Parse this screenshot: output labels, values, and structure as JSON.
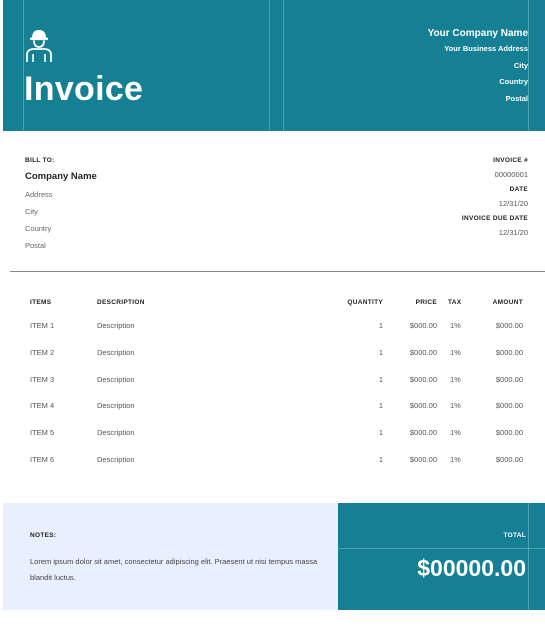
{
  "header": {
    "title": "Invoice",
    "icon": "construction-worker-icon",
    "company_name": "Your Company Name",
    "company_lines": [
      "Your Business Address",
      "City",
      "Country",
      "Postal"
    ],
    "accent_color": "#157f94"
  },
  "bill_to": {
    "label": "BILL TO:",
    "name": "Company Name",
    "lines": [
      "Address",
      "City",
      "Country",
      "Postal"
    ]
  },
  "meta": {
    "invoice_label": "INVOICE #",
    "invoice_number": "00000001",
    "date_label": "DATE",
    "date": "12/31/20",
    "due_label": "INVOICE DUE DATE",
    "due_date": "12/31/20"
  },
  "table": {
    "headers": {
      "items": "ITEMS",
      "description": "DESCRIPTION",
      "quantity": "QUANTITY",
      "price": "PRICE",
      "tax": "TAX",
      "amount": "AMOUNT"
    },
    "rows": [
      {
        "item": "ITEM 1",
        "description": "Description",
        "quantity": "1",
        "price": "$000.00",
        "tax": "1%",
        "amount": "$000.00"
      },
      {
        "item": "ITEM 2",
        "description": "Description",
        "quantity": "1",
        "price": "$000.00",
        "tax": "1%",
        "amount": "$000.00"
      },
      {
        "item": "ITEM 3",
        "description": "Description",
        "quantity": "1",
        "price": "$000.00",
        "tax": "1%",
        "amount": "$000.00"
      },
      {
        "item": "ITEM 4",
        "description": "Description",
        "quantity": "1",
        "price": "$000.00",
        "tax": "1%",
        "amount": "$000.00"
      },
      {
        "item": "ITEM 5",
        "description": "Description",
        "quantity": "1",
        "price": "$000.00",
        "tax": "1%",
        "amount": "$000.00"
      },
      {
        "item": "ITEM 6",
        "description": "Description",
        "quantity": "1",
        "price": "$000.00",
        "tax": "1%",
        "amount": "$000.00"
      }
    ]
  },
  "notes": {
    "label": "NOTES:",
    "text": "Lorem ipsum dolor sit amet, consectetur adipiscing elit. Praesent ut nisi tempus massa blandit luctus.",
    "background": "#e8f0fd"
  },
  "total": {
    "label": "TOTAL",
    "value": "$00000.00"
  }
}
